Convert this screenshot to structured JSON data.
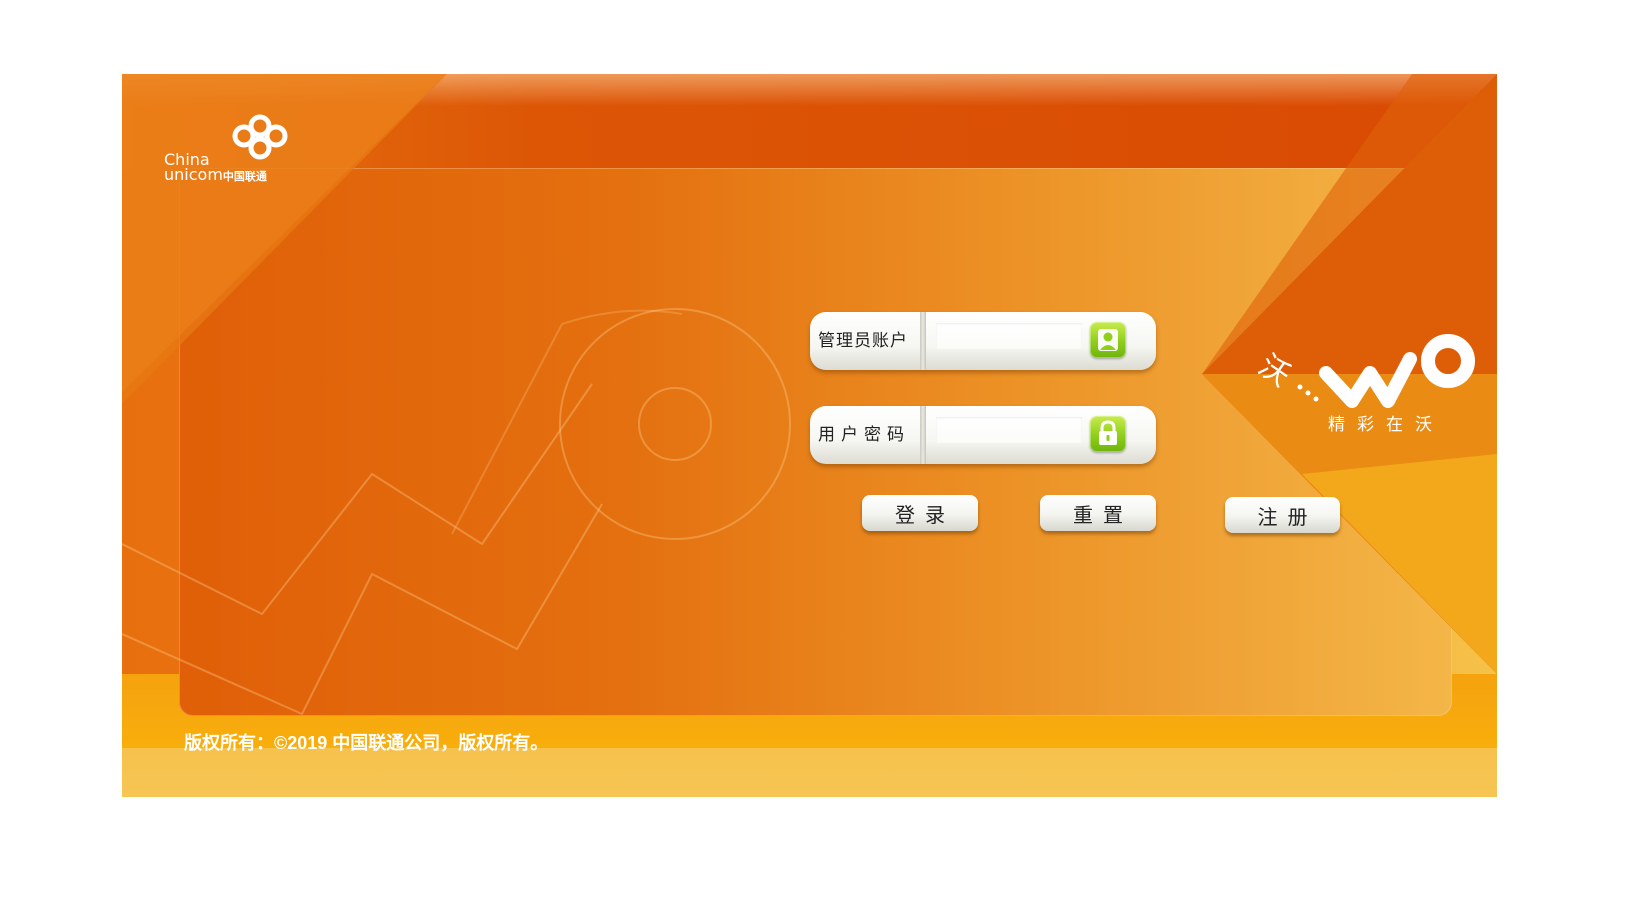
{
  "brand": {
    "logo_en_line1": "China",
    "logo_en_line2": "unicom",
    "logo_cn": "中国联通",
    "wo_logo_char": "沃",
    "wo_logo_word": "WO",
    "wo_slogan": "精彩在沃"
  },
  "form": {
    "username": {
      "label": "管理员账户",
      "value": "",
      "placeholder": ""
    },
    "password": {
      "label": "用户密码",
      "value": "",
      "placeholder": ""
    }
  },
  "buttons": {
    "login": "登录",
    "reset": "重置",
    "register": "注册"
  },
  "footer": {
    "copyright": "版权所有：©2019 中国联通公司，版权所有。"
  },
  "colors": {
    "primary_orange": "#e86f0e",
    "dark_orange": "#d94a03",
    "yellow": "#f8ae0c",
    "icon_green": "#8fce1a"
  },
  "icons": {
    "username_icon": "user-icon",
    "password_icon": "lock-icon"
  }
}
